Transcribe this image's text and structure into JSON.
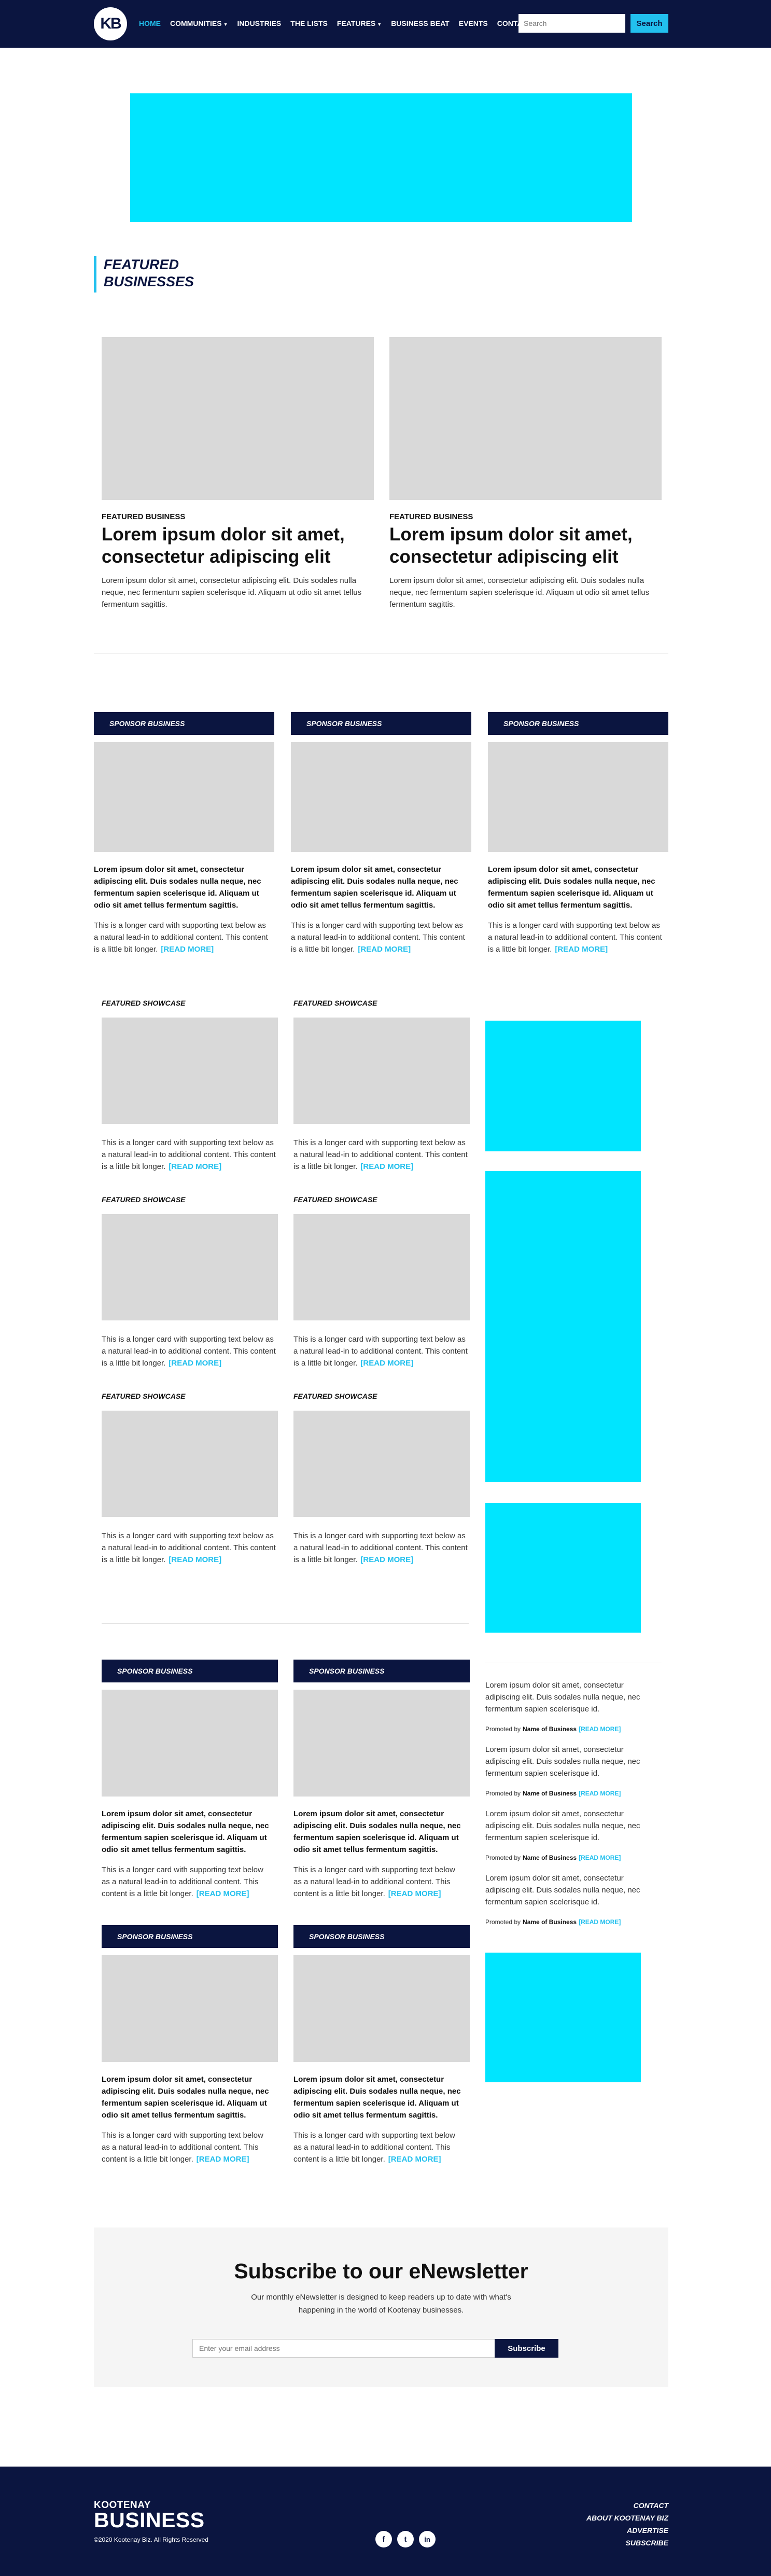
{
  "nav": {
    "logo": "KB",
    "items": [
      {
        "label": "HOME",
        "active": true,
        "caret": false
      },
      {
        "label": "COMMUNITIES",
        "active": false,
        "caret": true
      },
      {
        "label": "INDUSTRIES",
        "active": false,
        "caret": false
      },
      {
        "label": "THE LISTS",
        "active": false,
        "caret": false
      },
      {
        "label": "FEATURES",
        "active": false,
        "caret": true
      },
      {
        "label": "BUSINESS BEAT",
        "active": false,
        "caret": false
      },
      {
        "label": "EVENTS",
        "active": false,
        "caret": false
      },
      {
        "label": "CONTACT",
        "active": false,
        "caret": false
      }
    ],
    "search_placeholder": "Search",
    "search_button": "Search"
  },
  "featured_heading": [
    "FEATURED",
    "BUSINESSES"
  ],
  "featured": [
    {
      "kicker": "FEATURED BUSINESS",
      "title": "Lorem ipsum dolor sit amet, consectetur adipiscing elit",
      "text": "Lorem ipsum dolor sit amet, consectetur adipiscing elit. Duis sodales nulla neque, nec fermentum sapien scelerisque id. Aliquam ut odio sit amet tellus fermentum sagittis."
    },
    {
      "kicker": "FEATURED BUSINESS",
      "title": "Lorem ipsum dolor sit amet, consectetur adipiscing elit",
      "text": "Lorem ipsum dolor sit amet, consectetur adipiscing elit. Duis sodales nulla neque, nec fermentum sapien scelerisque id. Aliquam ut odio sit amet tellus fermentum sagittis."
    }
  ],
  "sponsor_label": "SPONSOR BUSINESS",
  "sponsor_bold": "Lorem ipsum dolor sit amet, consectetur adipiscing elit. Duis sodales nulla neque, nec fermentum sapien scelerisque id. Aliquam ut odio sit amet tellus fermentum sagittis.",
  "card_text": "This is a longer card with supporting text below as a natural lead-in to additional content. This content is a little bit longer.",
  "read_more": "[READ MORE]",
  "showcase_label": "FEATURED SHOWCASE",
  "promoted": {
    "text": "Lorem ipsum dolor sit amet, consectetur adipiscing elit. Duis sodales nulla neque, nec fermentum sapien scelerisque id.",
    "by_prefix": "Promoted by",
    "by_name": "Name of Business",
    "more": "[READ MORE]"
  },
  "newsletter": {
    "title": "Subscribe to our eNewsletter",
    "text": "Our monthly eNewsletter is designed to keep readers up to date with what's happening in the world of Kootenay businesses.",
    "placeholder": "Enter your email address",
    "button": "Subscribe"
  },
  "footer": {
    "logo_top": "KOOTENAY",
    "logo_bottom": "BUSINESS",
    "copyright": "©2020 Kootenay Biz. All Rights Reserved",
    "social": [
      "f",
      "t",
      "in"
    ],
    "links": [
      "CONTACT",
      "ABOUT KOOTENAY BIZ",
      "ADVERTISE",
      "SUBSCRIBE"
    ]
  },
  "colors": {
    "navy": "#0b1540",
    "accent": "#22c0ee",
    "ad": "#00e5ff",
    "placeholder": "#d9d9d9"
  }
}
